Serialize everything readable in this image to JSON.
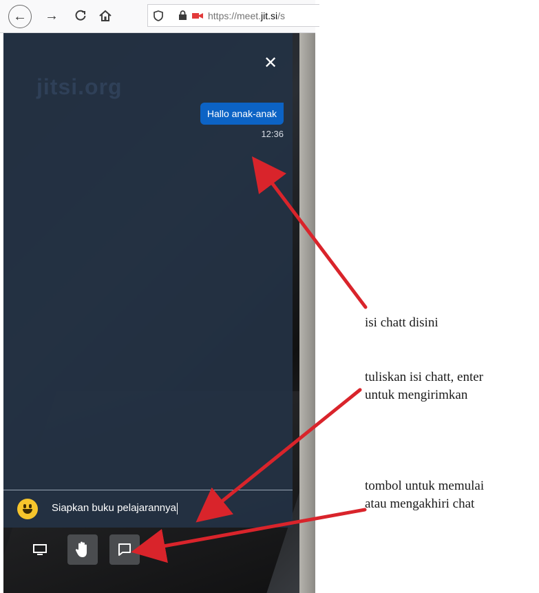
{
  "browser": {
    "url_prefix": "https://meet.",
    "url_domain": "jit.si",
    "url_suffix": "/s",
    "back_icon": "arrow-left-icon",
    "forward_icon": "arrow-right-icon",
    "reload_icon": "reload-icon",
    "home_icon": "home-icon"
  },
  "chat": {
    "watermark": "jitsi.org",
    "close_icon": "close-icon",
    "message_text": "Hallo anak-anak",
    "message_time": "12:36",
    "input_value": "Siapkan buku pelajarannya",
    "emoji_icon": "smiley-icon",
    "bubble_color": "#0c63c5",
    "panel_color": "#233144"
  },
  "toolbar": {
    "screen_share_icon": "screen-share-icon",
    "raise_hand_icon": "raise-hand-icon",
    "chat_icon": "chat-icon"
  },
  "annotations": {
    "note1": "isi chatt disini",
    "note2_line1": "tuliskan isi chatt, enter",
    "note2_line2": "untuk mengirimkan",
    "note3_line1": "tombol untuk memulai",
    "note3_line2": "atau mengakhiri chat",
    "arrow_color": "#d9242b"
  }
}
